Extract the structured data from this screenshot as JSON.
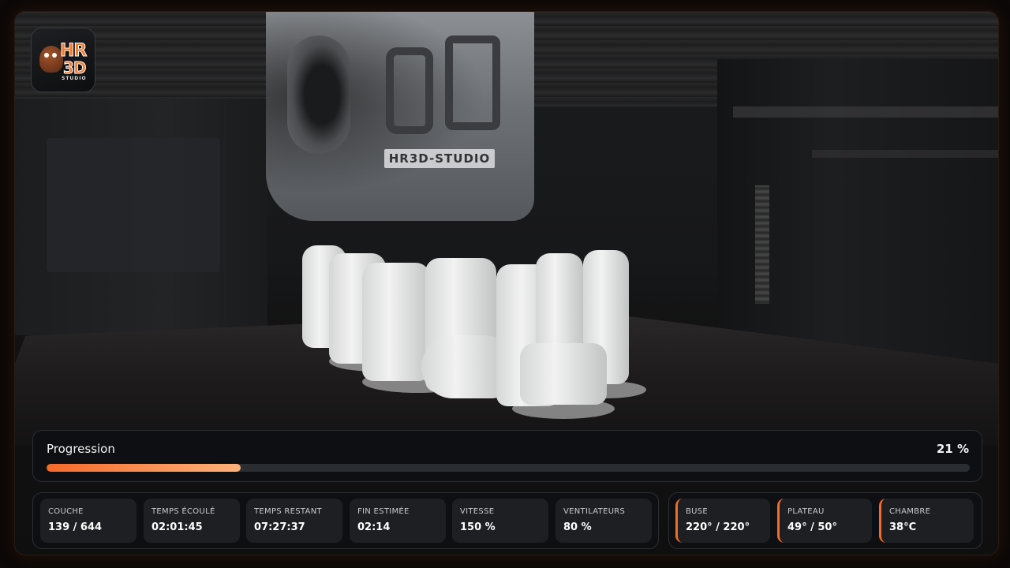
{
  "brand": {
    "logo_line1": "HR",
    "logo_line2": "3D",
    "logo_line3": "STUDIO",
    "printhead_plate": "HR3D-STUDIO"
  },
  "progress": {
    "label": "Progression",
    "value_text": "21 %",
    "fraction": 0.21,
    "fill_color": "#f46a2a"
  },
  "job_stats": [
    {
      "label": "Couche",
      "value": "139 / 644"
    },
    {
      "label": "Temps écoulé",
      "value": "02:01:45"
    },
    {
      "label": "Temps restant",
      "value": "07:27:37"
    },
    {
      "label": "Fin estimée",
      "value": "02:14"
    },
    {
      "label": "Vitesse",
      "value": "150 %"
    },
    {
      "label": "Ventilateurs",
      "value": "80 %"
    }
  ],
  "temperatures": [
    {
      "label": "Buse",
      "value": "220° / 220°"
    },
    {
      "label": "Plateau",
      "value": "49° / 50°"
    },
    {
      "label": "Chambre",
      "value": "38°C"
    }
  ],
  "colors": {
    "accent": "#f26d2c",
    "panel_bg": "#0d0f12",
    "tile_bg": "#1d1f23"
  }
}
